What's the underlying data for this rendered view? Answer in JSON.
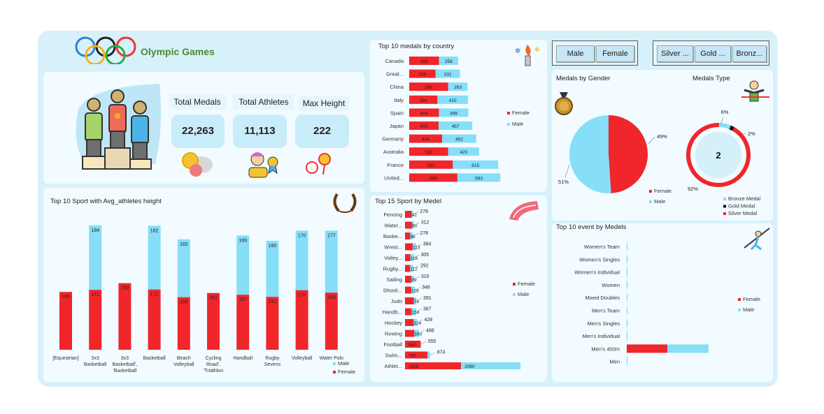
{
  "header": {
    "title": "Olympic Games"
  },
  "kpis": [
    {
      "label": "Total Medals",
      "value": "22,263"
    },
    {
      "label": "Total Athletes",
      "value": "11,113"
    },
    {
      "label": "Max Height",
      "value": "222"
    }
  ],
  "slicers": {
    "gender": [
      "Male",
      "Female"
    ],
    "medal": [
      "Silver ...",
      "Gold ...",
      "Bronz..."
    ]
  },
  "colors": {
    "female": "#f0262b",
    "male": "#86def8",
    "bronze": "#86def8",
    "gold": "#111111",
    "silver": "#f0262b"
  },
  "chart_data": [
    {
      "id": "height",
      "type": "bar",
      "title": "Top 10 Sport with Avg_athletes height",
      "categories": [
        [
          "[Equestrian]"
        ],
        [
          "3x3",
          "Basketball"
        ],
        [
          "3x3",
          "Basketball',",
          "'Basketball"
        ],
        [
          "Basketball"
        ],
        [
          "Beach",
          "Volleyball"
        ],
        [
          "Cycling",
          "Road',",
          "'Triathlon"
        ],
        [
          "Handball"
        ],
        [
          "Rugby",
          "Sevens"
        ],
        [
          "Volleyball"
        ],
        [
          "Water Polo"
        ]
      ],
      "series": [
        {
          "name": "Female",
          "values": [
            165,
            171,
            190,
            172,
            150,
            162,
            157,
            151,
            170,
            163
          ]
        },
        {
          "name": "Male",
          "values": [
            null,
            184,
            null,
            182,
            165,
            null,
            169,
            160,
            170,
            177
          ]
        }
      ],
      "legend": "bottom-right"
    },
    {
      "id": "country",
      "type": "bar",
      "orientation": "horizontal",
      "title": "Top 10 medals by country",
      "categories": [
        "Canada",
        "Great...",
        "China",
        "Italy",
        "Spain",
        "Japan",
        "Germany",
        "Australia",
        "France",
        "United..."
      ],
      "series": [
        {
          "name": "Female",
          "values": [
            406,
            359,
            530,
            384,
            404,
            400,
            448,
            530,
            593,
            655
          ]
        },
        {
          "name": "Male",
          "values": [
            258,
            331,
            263,
            415,
            399,
            457,
            462,
            420,
            615,
            583
          ]
        }
      ],
      "legend": "right"
    },
    {
      "id": "gender",
      "type": "pie",
      "title": "Medals by Gender",
      "slices": [
        {
          "name": "Female",
          "value": 49,
          "label": "49%"
        },
        {
          "name": "Male",
          "value": 51,
          "label": "51%"
        }
      ],
      "legend": "bottom"
    },
    {
      "id": "medaltype",
      "type": "pie",
      "title": "Medals Type",
      "center_label": "2",
      "slices": [
        {
          "name": "Bronze Medal",
          "value": 6,
          "label": "6%"
        },
        {
          "name": "Gold Medal",
          "value": 2,
          "label": "2%"
        },
        {
          "name": "Silver Medal",
          "value": 92,
          "label": "92%"
        }
      ],
      "legend": "bottom-right"
    },
    {
      "id": "sport",
      "type": "bar",
      "orientation": "horizontal",
      "title": "Top 15 Sport by Medel",
      "categories": [
        "Fencing",
        "Water...",
        "Baske...",
        "Wrest...",
        "Volley...",
        "Rugby...",
        "Sailing",
        "Shooti...",
        "Judo",
        "Handb...",
        "Hockey",
        "Rowing",
        "Football",
        "Swim...",
        "Athlet..."
      ],
      "series": [
        {
          "name": "Female",
          "values": [
            236,
            252,
            182,
            271,
            189,
            180,
            226,
            218,
            313,
            233,
            304,
            328,
            550,
            790,
            1958
          ]
        },
        {
          "name": "Male",
          "values": [
            42,
            60,
            96,
            113,
            116,
            112,
            89,
            128,
            78,
            154,
            124,
            160,
            5,
            84,
            2080
          ]
        }
      ],
      "totals": [
        "278",
        "312",
        "278",
        "384",
        "305",
        "292",
        "315",
        "346",
        "391",
        "387",
        "428",
        "488",
        "555",
        "874",
        ""
      ],
      "female_labels": [
        "",
        "",
        "",
        "",
        "",
        "",
        "",
        "",
        "",
        "",
        "",
        "",
        "550",
        "790",
        "1958"
      ],
      "male_labels": [
        "42",
        "60",
        "96",
        "113",
        "116",
        "112",
        "89",
        "128",
        "78",
        "154",
        "124",
        "160",
        "",
        "",
        "2080"
      ],
      "legend": "right"
    },
    {
      "id": "event",
      "type": "bar",
      "orientation": "horizontal",
      "title": "Top 10 event by Medels",
      "categories": [
        "Women's Team",
        "Women's Singles",
        "Women's Individual",
        "Women",
        "Mixed Doubles",
        "Men's Team",
        "Men's Singles",
        "Men's Individual",
        "Men's 400m",
        "Men"
      ],
      "series": [
        {
          "name": "Female",
          "values": [
            0,
            0,
            0,
            0,
            0,
            0,
            0,
            0,
            58,
            0
          ]
        },
        {
          "name": "Male",
          "values": [
            0,
            0,
            0,
            0,
            0,
            0,
            0,
            0,
            59,
            0
          ]
        }
      ],
      "legend": "right"
    }
  ]
}
